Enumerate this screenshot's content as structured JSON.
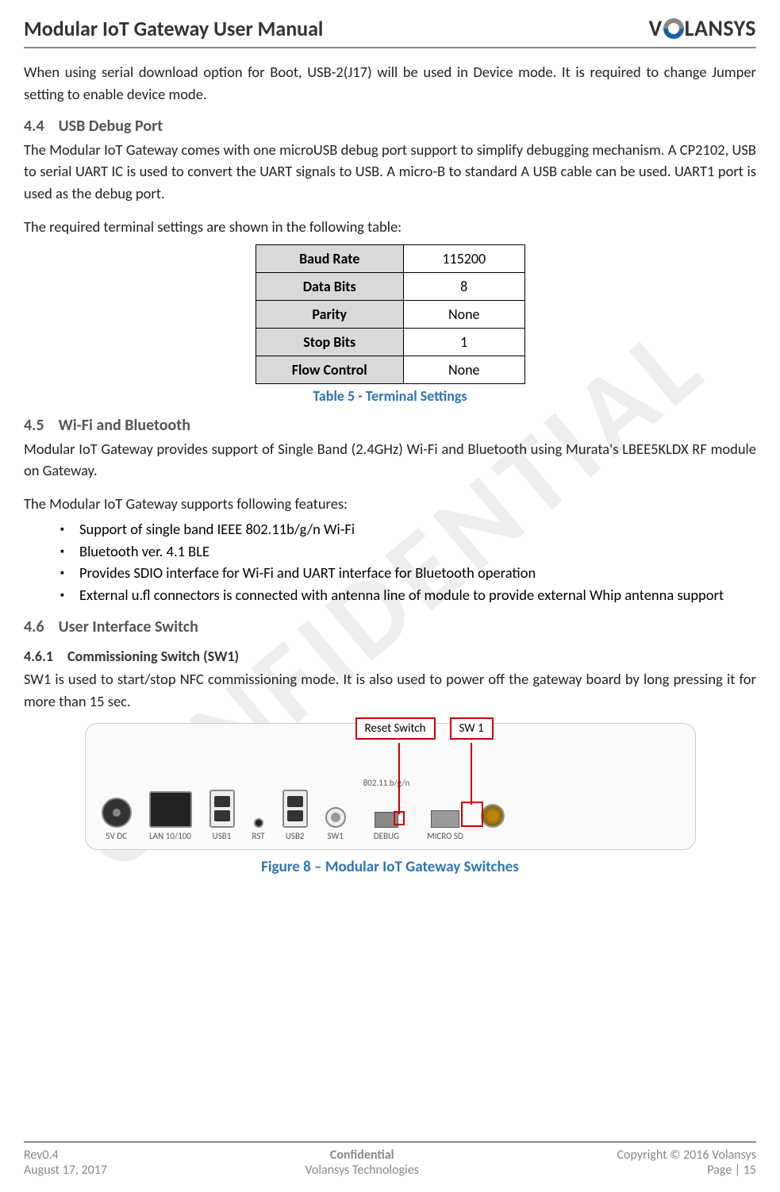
{
  "header": {
    "title": "Modular IoT Gateway User Manual",
    "logo_text_pre": "V",
    "logo_text_post": "LANSYS"
  },
  "watermark": "CONFIDENTIAL",
  "intro_para": "When using serial download option for Boot, USB-2(J17) will be used in Device mode. It is required to change Jumper setting to enable device mode.",
  "sec44": {
    "num": "4.4",
    "title": "USB Debug Port",
    "p1": "The Modular IoT Gateway comes with one microUSB debug port support to simplify debugging mechanism. A CP2102, USB to serial UART IC is used to convert the UART signals to USB. A micro-B to standard A USB cable can be used. UART1 port is used as the debug port.",
    "p2": "The required terminal settings are shown in the following table:"
  },
  "terminal_table": {
    "rows": [
      {
        "label": "Baud Rate",
        "value": "115200"
      },
      {
        "label": "Data Bits",
        "value": "8"
      },
      {
        "label": "Parity",
        "value": "None"
      },
      {
        "label": "Stop Bits",
        "value": "1"
      },
      {
        "label": "Flow Control",
        "value": "None"
      }
    ],
    "caption": "Table 5 - Terminal Settings"
  },
  "sec45": {
    "num": "4.5",
    "title": "Wi-Fi and Bluetooth",
    "p1": "Modular IoT Gateway provides support of Single Band (2.4GHz) Wi-Fi and Bluetooth using Murata's LBEE5KLDX RF module on Gateway.",
    "p2": "The Modular IoT Gateway supports following features:",
    "features": [
      "Support of single band IEEE 802.11b/g/n Wi-Fi",
      "Bluetooth ver. 4.1 BLE",
      "Provides SDIO interface for Wi-Fi and UART interface for Bluetooth operation",
      "External u.fl connectors is connected with antenna line of module to provide external Whip antenna support"
    ]
  },
  "sec46": {
    "num": "4.6",
    "title": "User Interface Switch"
  },
  "sec461": {
    "num": "4.6.1",
    "title": "Commissioning Switch (SW1)",
    "p1": "SW1 is used to start/stop NFC commissioning mode. It is also used to power off the gateway board by long pressing it for more than 15 sec."
  },
  "figure": {
    "callout_reset": "Reset Switch",
    "callout_sw1": "SW 1",
    "labels": {
      "dc": "5V DC",
      "lan": "LAN 10/100",
      "usb1": "USB1",
      "rst": "RST",
      "usb2": "USB2",
      "sw1": "SW1",
      "debug": "DEBUG",
      "wifi": "802.11 b/g/n",
      "sd": "MICRO SD"
    },
    "caption": "Figure 8 – Modular IoT Gateway Switches"
  },
  "footer": {
    "rev": "Rev0.4",
    "date": "August 17, 2017",
    "conf": "Confidential",
    "company": "Volansys Technologies",
    "copyright": "Copyright © 2016 Volansys",
    "page": "Page | 15"
  }
}
